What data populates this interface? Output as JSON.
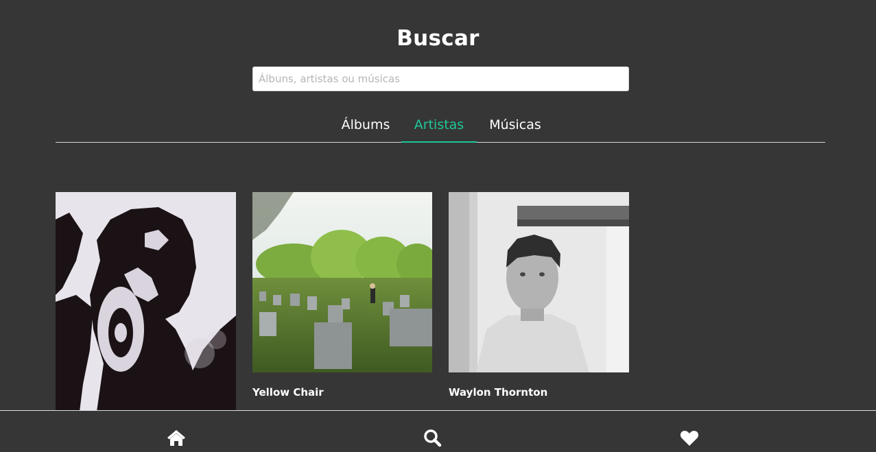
{
  "header": {
    "title": "Buscar"
  },
  "search": {
    "placeholder": "Álbuns, artistas ou músicas",
    "value": ""
  },
  "tabs": [
    {
      "label": "Álbums",
      "active": false
    },
    {
      "label": "Artistas",
      "active": true
    },
    {
      "label": "Músicas",
      "active": false
    }
  ],
  "results": [
    {
      "name": "",
      "image": "artist-collage-portrait"
    },
    {
      "name": "Yellow Chair",
      "image": "cemetery-photo"
    },
    {
      "name": "Waylon Thornton",
      "image": "bw-portrait-photo"
    }
  ],
  "bottom_nav": {
    "items": [
      {
        "icon": "home-icon"
      },
      {
        "icon": "search-icon"
      },
      {
        "icon": "heart-icon"
      }
    ]
  },
  "colors": {
    "background": "#363636",
    "accent": "#1ec99a",
    "text": "#ffffff"
  }
}
